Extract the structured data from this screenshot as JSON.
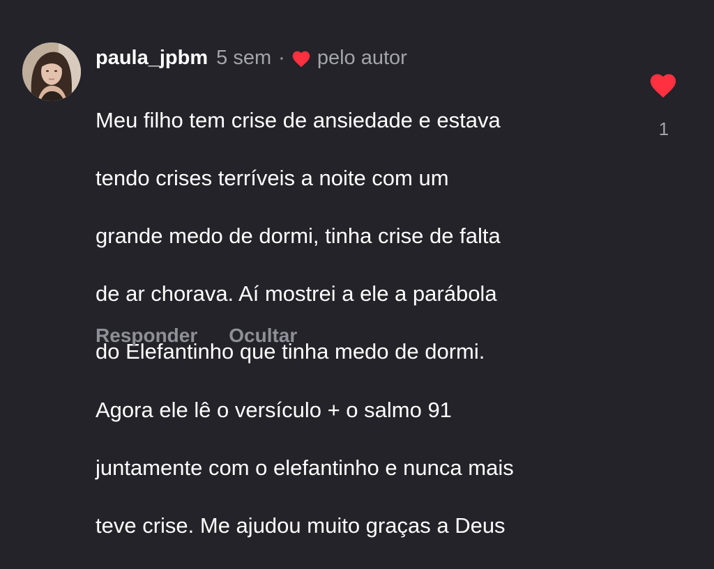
{
  "comment": {
    "username": "paula_jpbm",
    "time_ago": "5 sem",
    "separator": "·",
    "liked_by_author_label": "pelo autor",
    "text_lines": [
      "Meu filho tem crise de ansiedade e estava",
      "tendo crises terríveis a noite com um",
      "grande medo de dormi, tinha crise de falta",
      "de ar chorava. Aí mostrei a  ele a parábola",
      "do Elefantinho que tinha medo de dormi.",
      "Agora ele lê o versículo + o salmo 91",
      "juntamente com o elefantinho e nunca mais",
      "teve crise. Me ajudou muito graças a Deus"
    ],
    "reply_label": "Responder",
    "hide_label": "Ocultar",
    "like_count": "1",
    "like_icon": "heart-icon",
    "liked": true
  },
  "colors": {
    "background": "#232329",
    "heart": "#ff3040",
    "muted_text": "#a4a4ab",
    "action_text": "#8f8f97"
  }
}
